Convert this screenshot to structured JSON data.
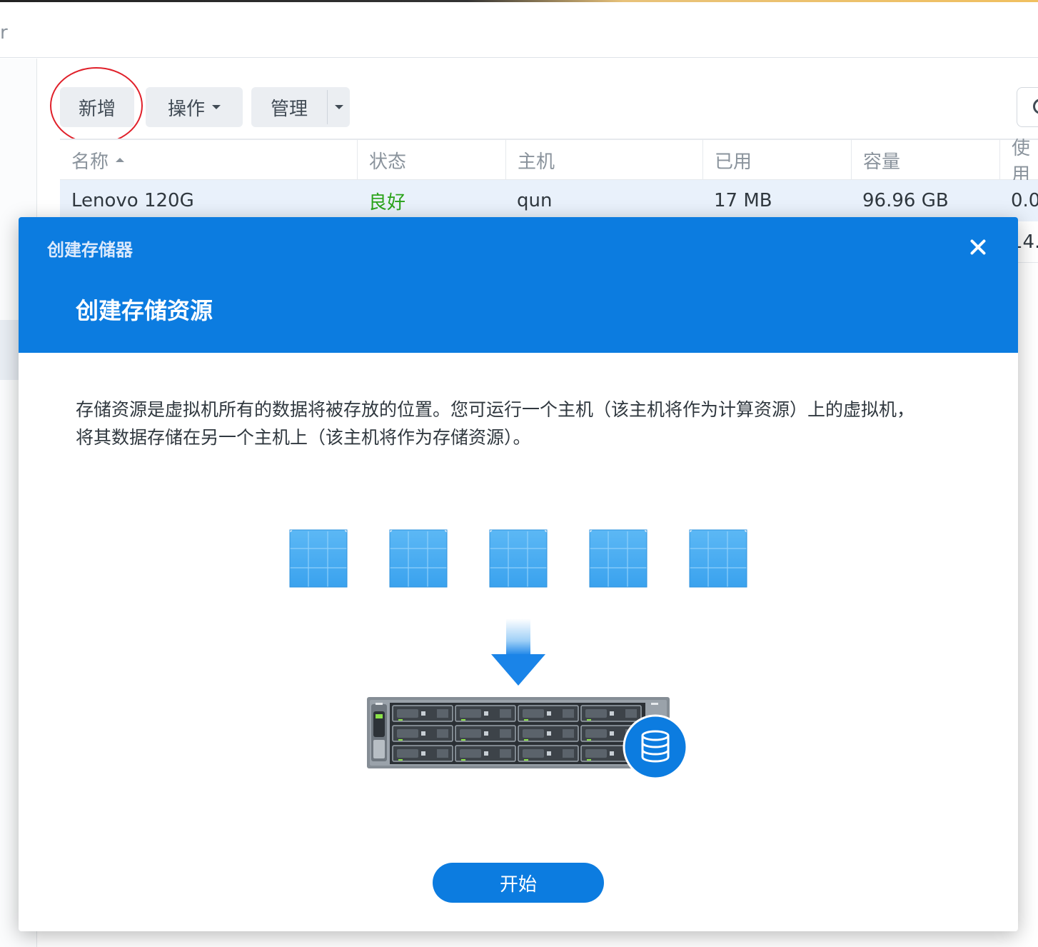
{
  "window": {
    "title_fragment": "r"
  },
  "toolbar": {
    "add_label": "新增",
    "actions_label": "操作",
    "manage_label": "管理"
  },
  "table": {
    "columns": [
      "名称",
      "状态",
      "主机",
      "已用",
      "容量",
      "使用"
    ],
    "rows": [
      {
        "name": "Lenovo 120G",
        "status": "良好",
        "host": "qun",
        "used": "17 MB",
        "capacity": "96.96 GB",
        "usage": "0.0"
      },
      {
        "name": "",
        "status": "",
        "host": "",
        "used": "",
        "capacity": "",
        "usage": "14."
      }
    ]
  },
  "dialog": {
    "window_title": "创建存储器",
    "step_title": "创建存储资源",
    "description_line1": "存储资源是虚拟机所有的数据将被存放的位置。您可运行一个主机（该主机将作为计算资源）上的虚拟机，",
    "description_line2": "将其数据存储在另一个主机上（该主机将作为存储资源）。",
    "start_label": "开始"
  },
  "colors": {
    "accent": "#0c7ce0",
    "status_good": "#2aa31a",
    "highlight_ring": "#e0202a",
    "cube": "#4aacf2"
  },
  "icons": {
    "close": "close-icon",
    "search": "search-icon",
    "database": "database-icon",
    "arrow": "arrow-down-icon"
  }
}
